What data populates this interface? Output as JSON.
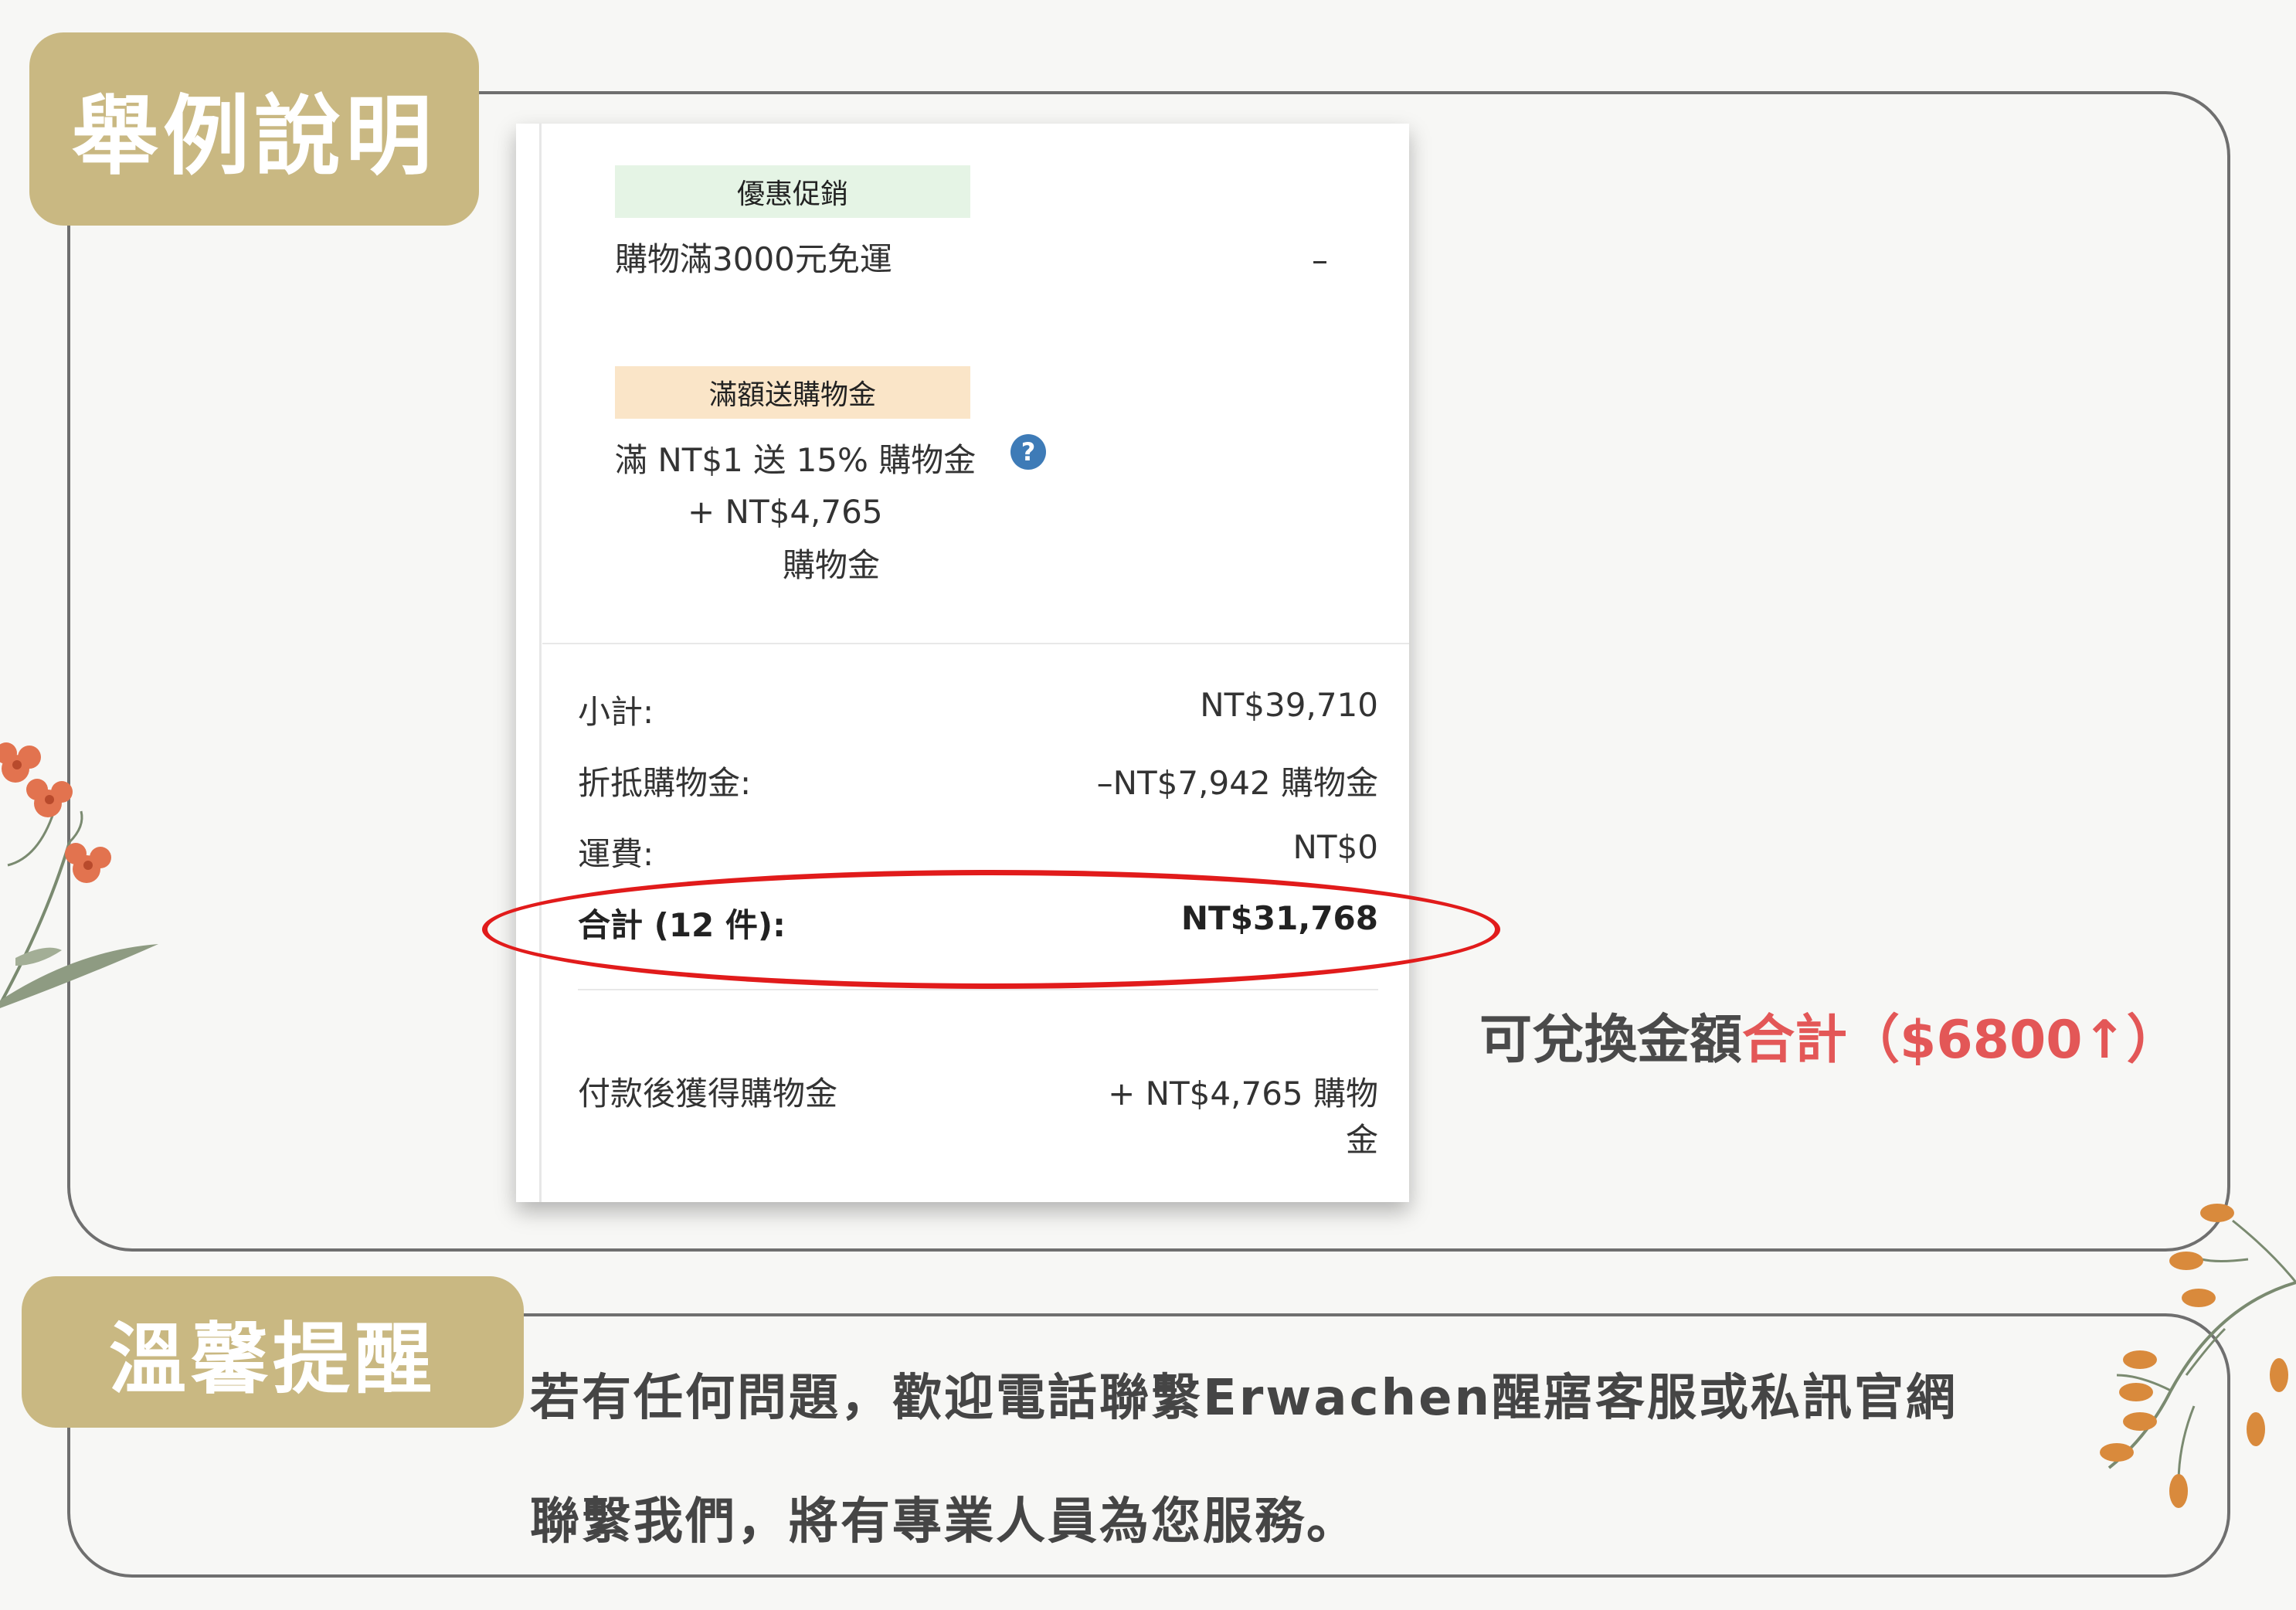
{
  "sections": {
    "example_badge": "舉例說明",
    "reminder_badge": "溫馨提醒"
  },
  "card": {
    "promo_tag": "優惠促銷",
    "promo_text": "購物滿3000元免運",
    "promo_value": "–",
    "credit_tag": "滿額送購物金",
    "credit_text": "滿 NT$1 送 15% 購物金",
    "credit_amount": "+ NT$4,765",
    "credit_unit": "購物金",
    "summary": [
      {
        "label": "小計:",
        "value": "NT$39,710"
      },
      {
        "label": "折抵購物金:",
        "value": "–NT$7,942 購物金"
      },
      {
        "label": "運費:",
        "value": "NT$0"
      },
      {
        "label": "合計 (12 件):",
        "value": "NT$31,768"
      }
    ],
    "earned_label": "付款後獲得購物金",
    "earned_value_line1": "+ NT$4,765 購物",
    "earned_value_line2": "金"
  },
  "note": {
    "prefix": "可兌換金額",
    "highlight": "合計（$6800↑）"
  },
  "message": {
    "line1": "若有任何問題，歡迎電話聯繫Erwachen醒寤客服或私訊官網",
    "line2": "聯繫我們，將有專業人員為您服務。"
  },
  "colors": {
    "badge": "#c9b882",
    "frame": "#6f6f6f",
    "highlight_red": "#e35757",
    "circle_red": "#e11b1b",
    "help_icon": "#3e7bb7"
  },
  "icons": {
    "help": "question-circle-icon"
  }
}
